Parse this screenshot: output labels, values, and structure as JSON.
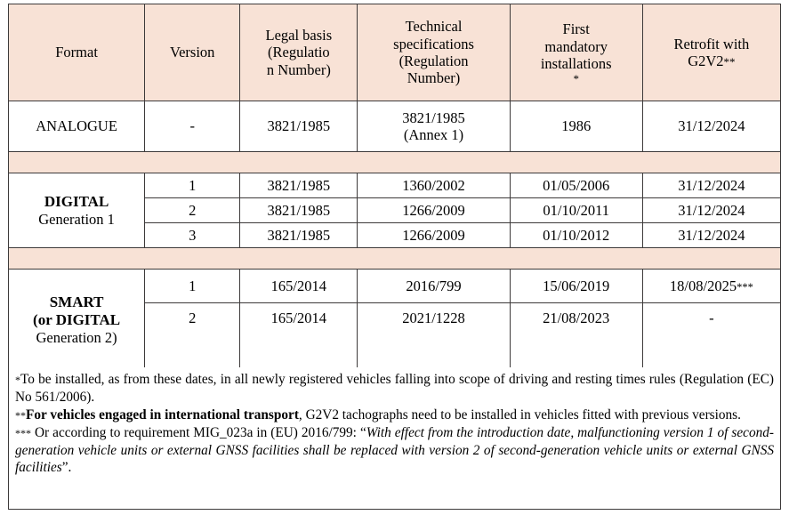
{
  "table": {
    "headers": [
      {
        "label": "Format"
      },
      {
        "label": "Version"
      },
      {
        "line1": "Legal basis",
        "line2": "(Regulatio",
        "line3": "n Number)"
      },
      {
        "line1": "Technical",
        "line2": "specifications",
        "line3": "(Regulation",
        "line4": "Number)"
      },
      {
        "line1": "First",
        "line2": "mandatory",
        "line3": "installations",
        "line4": "*"
      },
      {
        "line1": "Retrofit with",
        "line2": "G2V2",
        "marker": "**"
      }
    ],
    "rows": {
      "analogue": {
        "format": "ANALOGUE",
        "version": "-",
        "legal_basis": "3821/1985",
        "tech_spec_line1": "3821/1985",
        "tech_spec_line2": "(Annex 1)",
        "first_mandatory": "1986",
        "retrofit": "31/12/2024"
      },
      "digital": {
        "format_bold": "DIGITAL",
        "format_sub": "Generation 1",
        "items": [
          {
            "version": "1",
            "legal_basis": "3821/1985",
            "tech_spec": "1360/2002",
            "first_mandatory": "01/05/2006",
            "retrofit": "31/12/2024"
          },
          {
            "version": "2",
            "legal_basis": "3821/1985",
            "tech_spec": "1266/2009",
            "first_mandatory": "01/10/2011",
            "retrofit": "31/12/2024"
          },
          {
            "version": "3",
            "legal_basis": "3821/1985",
            "tech_spec": "1266/2009",
            "first_mandatory": "01/10/2012",
            "retrofit": "31/12/2024"
          }
        ]
      },
      "smart": {
        "format_line1": "SMART",
        "format_line2": "(or DIGITAL",
        "format_line3": "Generation 2)",
        "items": [
          {
            "version": "1",
            "legal_basis": "165/2014",
            "tech_spec": "2016/799",
            "first_mandatory": "15/06/2019",
            "retrofit": "18/08/2025",
            "retrofit_marker": "***"
          },
          {
            "version": "2",
            "legal_basis": "165/2014",
            "tech_spec": "2021/1228",
            "first_mandatory": "21/08/2023",
            "retrofit": "-",
            "retrofit_marker": ""
          }
        ]
      }
    }
  },
  "notes": {
    "note1": {
      "mark": "*",
      "text": "To be installed, as from these dates, in all newly registered vehicles falling into scope of driving and resting times rules (Regulation (EC) No 561/2006)."
    },
    "note2": {
      "mark": "**",
      "bold": "For vehicles engaged in international transport",
      "text": ", G2V2 tachographs need to be installed in vehicles fitted with previous versions."
    },
    "note3": {
      "mark": "***",
      "text_before": " Or according to requirement MIG_023a in (EU) 2016/799: “",
      "italic": "With effect from the introduction date, malfunctioning version 1 of second-generation vehicle units or external GNSS facilities shall be replaced with version 2 of second-generation vehicle units or external GNSS facilities",
      "text_after": "”."
    }
  },
  "colors": {
    "header_bg": "#F8E2D6",
    "border": "#3D3A3A",
    "text": "#000000",
    "page_bg": "#FFFFFF"
  }
}
